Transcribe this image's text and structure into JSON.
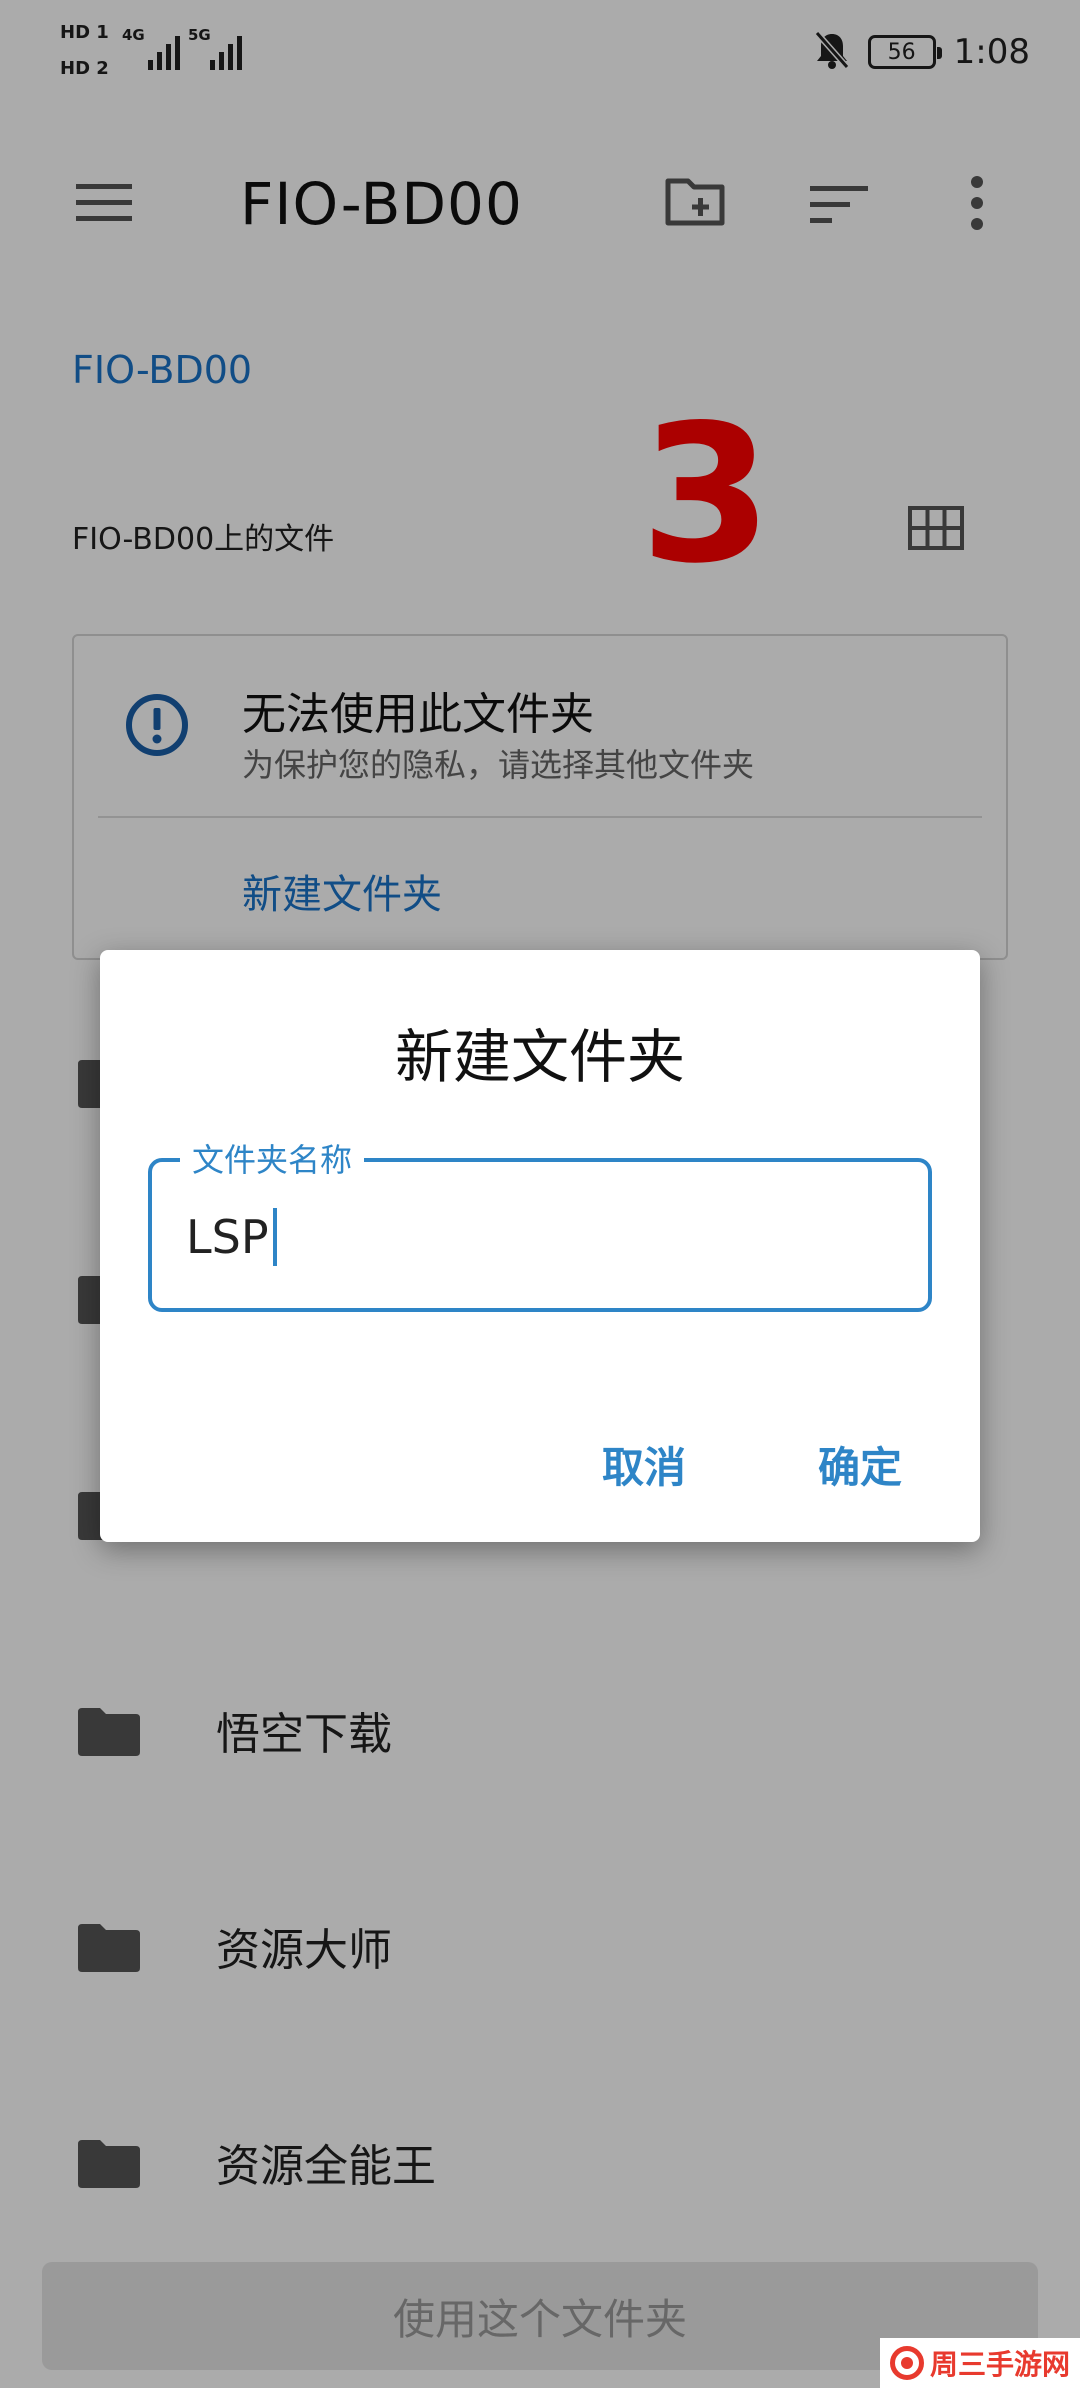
{
  "status_bar": {
    "sim1": "HD 1",
    "sim2": "HD 2",
    "net1": "4G",
    "net2": "5G",
    "battery": "56",
    "time": "1:08"
  },
  "appbar": {
    "title": "FIO-BD00",
    "icons": [
      "menu-icon",
      "new-folder-icon",
      "sort-icon",
      "more-vert-icon"
    ]
  },
  "breadcrumb": "FIO-BD00",
  "files_on_label": "FIO-BD00上的文件",
  "annotation_number": "3",
  "warning_card": {
    "title": "无法使用此文件夹",
    "subtitle": "为保护您的隐私，请选择其他文件夹",
    "action": "新建文件夹"
  },
  "folders": [
    {
      "label": ""
    },
    {
      "label": ""
    },
    {
      "label": ""
    },
    {
      "label": "悟空下载"
    },
    {
      "label": "资源大师"
    },
    {
      "label": "资源全能王"
    }
  ],
  "bottom_button": "使用这个文件夹",
  "dialog": {
    "title": "新建文件夹",
    "field_label": "文件夹名称",
    "field_value": "LSP",
    "cancel": "取消",
    "confirm": "确定"
  },
  "colors": {
    "accent": "#2e85c7",
    "link": "#1a73c8",
    "annotation": "#ff0000"
  },
  "watermark": "周三手游网"
}
